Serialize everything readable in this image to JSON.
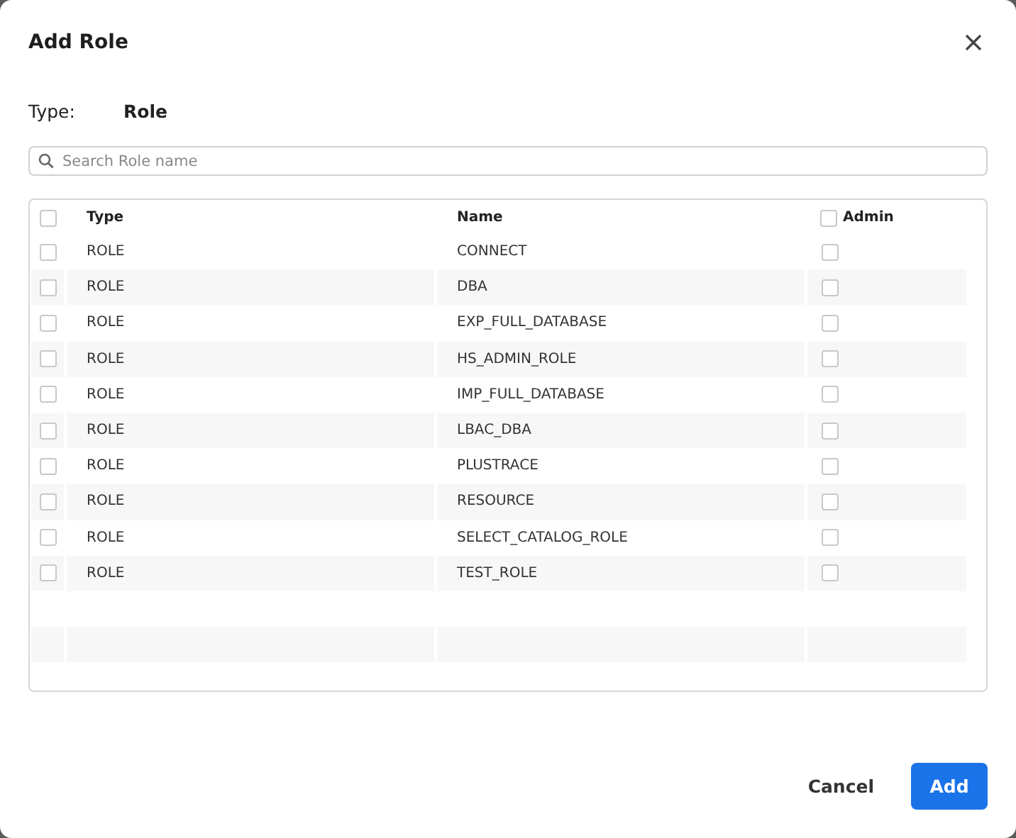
{
  "dialog": {
    "title": "Add Role"
  },
  "type_field": {
    "label": "Type:",
    "value": "Role"
  },
  "search": {
    "placeholder": "Search Role name"
  },
  "table": {
    "select_all_checked": false,
    "columns": [
      "Type",
      "Name",
      "Admin"
    ],
    "admin_all_checked": false,
    "rows": [
      {
        "type": "ROLE",
        "name": "CONNECT",
        "checked": false,
        "admin": false
      },
      {
        "type": "ROLE",
        "name": "DBA",
        "checked": false,
        "admin": false
      },
      {
        "type": "ROLE",
        "name": "EXP_FULL_DATABASE",
        "checked": false,
        "admin": false
      },
      {
        "type": "ROLE",
        "name": "HS_ADMIN_ROLE",
        "checked": false,
        "admin": false
      },
      {
        "type": "ROLE",
        "name": "IMP_FULL_DATABASE",
        "checked": false,
        "admin": false
      },
      {
        "type": "ROLE",
        "name": "LBAC_DBA",
        "checked": false,
        "admin": false
      },
      {
        "type": "ROLE",
        "name": "PLUSTRACE",
        "checked": false,
        "admin": false
      },
      {
        "type": "ROLE",
        "name": "RESOURCE",
        "checked": false,
        "admin": false
      },
      {
        "type": "ROLE",
        "name": "SELECT_CATALOG_ROLE",
        "checked": false,
        "admin": false
      },
      {
        "type": "ROLE",
        "name": "TEST_ROLE",
        "checked": false,
        "admin": false
      }
    ]
  },
  "buttons": {
    "cancel": "Cancel",
    "add": "Add"
  }
}
